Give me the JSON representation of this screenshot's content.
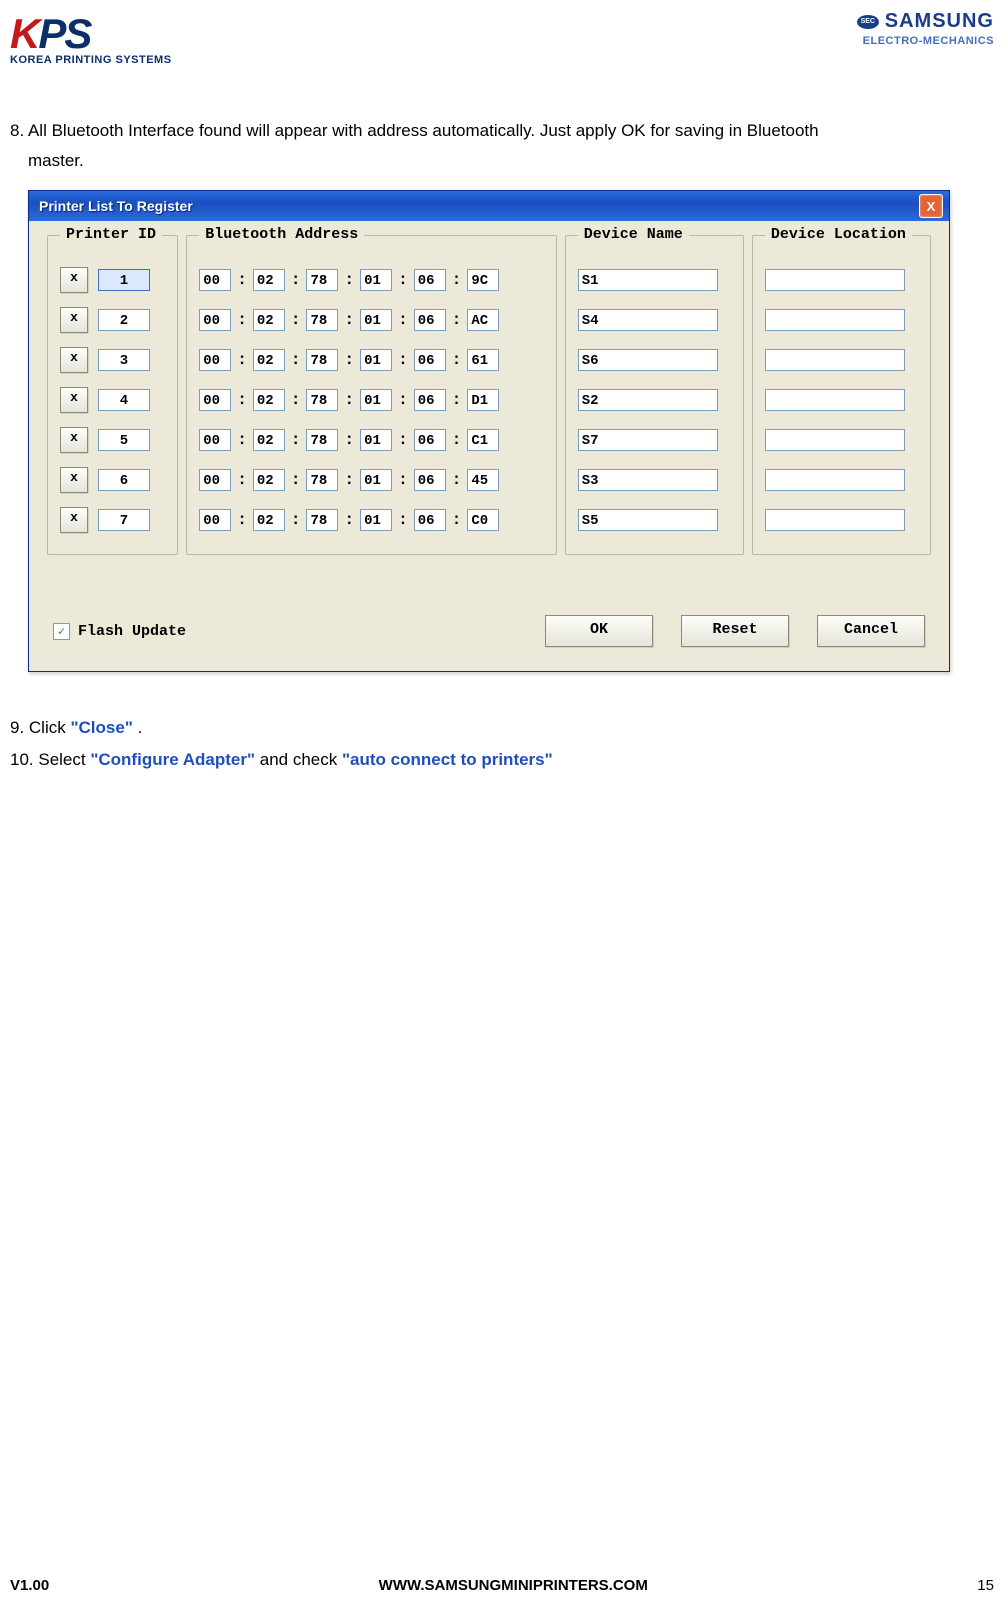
{
  "header": {
    "kps_k": "K",
    "kps_ps": "PS",
    "kps_sub": "KOREA PRINTING SYSTEMS",
    "samsung_oval": "SEC",
    "samsung": "SAMSUNG",
    "samsung_sub": "ELECTRO-MECHANICS"
  },
  "step8_part1": "8. All Bluetooth Interface found will appear with address automatically. Just apply OK for saving in Bluetooth",
  "step8_part2": "master.",
  "dialog": {
    "title": "Printer List To Register",
    "close_x": "X",
    "group_id": "Printer ID",
    "group_addr": "Bluetooth Address",
    "group_name": "Device Name",
    "group_loc": "Device Location",
    "x_label": "x",
    "colon": ":",
    "rows": [
      {
        "id": "1",
        "addr": [
          "00",
          "02",
          "78",
          "01",
          "06",
          "9C"
        ],
        "name": "S1",
        "loc": ""
      },
      {
        "id": "2",
        "addr": [
          "00",
          "02",
          "78",
          "01",
          "06",
          "AC"
        ],
        "name": "S4",
        "loc": ""
      },
      {
        "id": "3",
        "addr": [
          "00",
          "02",
          "78",
          "01",
          "06",
          "61"
        ],
        "name": "S6",
        "loc": ""
      },
      {
        "id": "4",
        "addr": [
          "00",
          "02",
          "78",
          "01",
          "06",
          "D1"
        ],
        "name": "S2",
        "loc": ""
      },
      {
        "id": "5",
        "addr": [
          "00",
          "02",
          "78",
          "01",
          "06",
          "C1"
        ],
        "name": "S7",
        "loc": ""
      },
      {
        "id": "6",
        "addr": [
          "00",
          "02",
          "78",
          "01",
          "06",
          "45"
        ],
        "name": "S3",
        "loc": ""
      },
      {
        "id": "7",
        "addr": [
          "00",
          "02",
          "78",
          "01",
          "06",
          "C0"
        ],
        "name": "S5",
        "loc": ""
      }
    ],
    "flash_check": "✓",
    "flash_label": "Flash Update",
    "btn_ok": "OK",
    "btn_reset": "Reset",
    "btn_cancel": "Cancel"
  },
  "step9": {
    "prefix": "9. Click ",
    "blue": "\"Close\"",
    "suffix": " ."
  },
  "step10": {
    "prefix": "10. Select ",
    "blue1": "\"Configure Adapter\"",
    "mid": " and check ",
    "blue2": "\"auto connect to printers\""
  },
  "footer": {
    "version": "V1.00",
    "url": "WWW.SAMSUNGMINIPRINTERS.COM",
    "page": "15"
  }
}
